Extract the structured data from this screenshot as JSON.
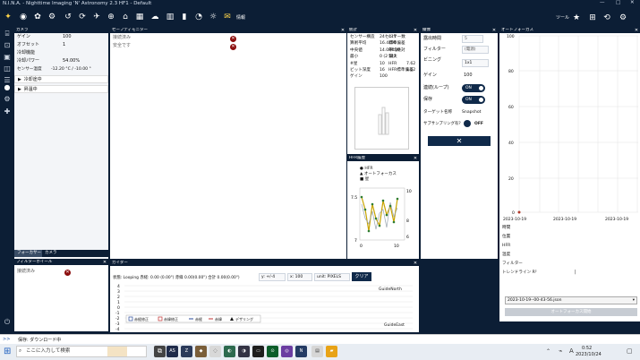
{
  "window": {
    "title": "N.I.N.A. - Nighttime Imaging 'N' Astronomy 2.3 HF1 - Default"
  },
  "toolbar": {
    "info_label": "情報",
    "right_label": "ツール"
  },
  "camera": {
    "header": "カメラ",
    "rows": [
      {
        "label": "ゲイン",
        "value": "100"
      },
      {
        "label": "オフセット",
        "value": "1"
      },
      {
        "label": "冷却機能",
        "value": ""
      },
      {
        "label": "冷却パワー",
        "value": "54.00%"
      },
      {
        "label": "センサー温度",
        "value": "-12.20 °C / -10.00 °"
      }
    ],
    "warming": "冷却途中",
    "cooling": "昇温中",
    "tabs": [
      "フォーカサー",
      "カメラ"
    ]
  },
  "filterwheel": {
    "header": "フィルターホイール",
    "status": "接続済み"
  },
  "safety": {
    "header": "セーフティモニター",
    "rows": [
      "接続済み",
      "安全です"
    ]
  },
  "stats": {
    "header": "統計",
    "rows": [
      [
        "センサー構造",
        "24センサー数",
        "417"
      ],
      [
        "算術平均",
        "16.4標準偏差",
        "196"
      ],
      [
        "中央値",
        "14.0平均絶対",
        "84.00"
      ],
      [
        "最小",
        "0 (2 最大",
        "542"
      ],
      [
        "#星",
        "10",
        "HFR",
        "7.62"
      ],
      [
        "ビット深度",
        "16",
        "HFR標準偏差",
        "1.52"
      ],
      [
        "ゲイン",
        "100"
      ]
    ]
  },
  "imaging": {
    "header": "撮像",
    "rows": [
      {
        "label": "露出時間",
        "value": "5"
      },
      {
        "label": "フィルター",
        "value": "(電源)"
      },
      {
        "label": "ビニング",
        "value": "1x1"
      },
      {
        "label": "ゲイン",
        "value": "100"
      },
      {
        "label": "連続(ループ)",
        "value": "ON"
      },
      {
        "label": "保存",
        "value": "ON"
      },
      {
        "label": "ターゲット名称",
        "value": "Snapshot"
      },
      {
        "label": "サブサンプリング有?",
        "value": "OFF"
      }
    ],
    "cancel": "✕"
  },
  "hfr": {
    "header": "HFR履歴",
    "legend": [
      "HFR",
      "オートフォーカス",
      "星"
    ],
    "yl": [
      "7.5",
      "7"
    ],
    "yr": [
      "10",
      "8",
      "6"
    ],
    "x": [
      "0",
      "10"
    ]
  },
  "autofocus": {
    "header": "オートフォーカス",
    "yaxis": [
      "100",
      "80",
      "60",
      "40",
      "20",
      "0"
    ],
    "xaxis": [
      "2023-10-19",
      "2023-10-19",
      "2023-10-19"
    ],
    "info": [
      "時間",
      "位置",
      "HFR",
      "温度",
      "フィルター",
      "トレンドライン R²"
    ],
    "info_value": "|",
    "file": "2023-10-19--00-43-56.json",
    "start": "オートフォーカス開始"
  },
  "guider": {
    "header": "ガイダー",
    "status": "状態: Looping 赤経: 0.00 (0.00\") 赤緯 0.00(0.00\") 合計 0.00(0.00\")",
    "yscale": "y: +/-4",
    "xscale": "x: 100",
    "unit": "unit: PIXELS",
    "clear": "クリア",
    "yticks": [
      "4",
      "3",
      "2",
      "1",
      "0",
      "-1",
      "-2",
      "-3",
      "-4"
    ],
    "north": "GuideNorth",
    "east": "GuideEast",
    "legend": [
      "赤経修正",
      "赤緯修正",
      "赤経",
      "赤緯",
      "デザリング"
    ]
  },
  "status": {
    "text": "保存: ダウンロード中"
  },
  "taskbar": {
    "search": "ここに入力して検索",
    "time": "0:52",
    "date": "2023/10/24"
  },
  "colors": {
    "navy": "#0c1e35",
    "toggle": "#102a4a",
    "error": "#8b0d0d",
    "hfr_line": "#c8a400",
    "hfr_point": "#2e7d32"
  }
}
